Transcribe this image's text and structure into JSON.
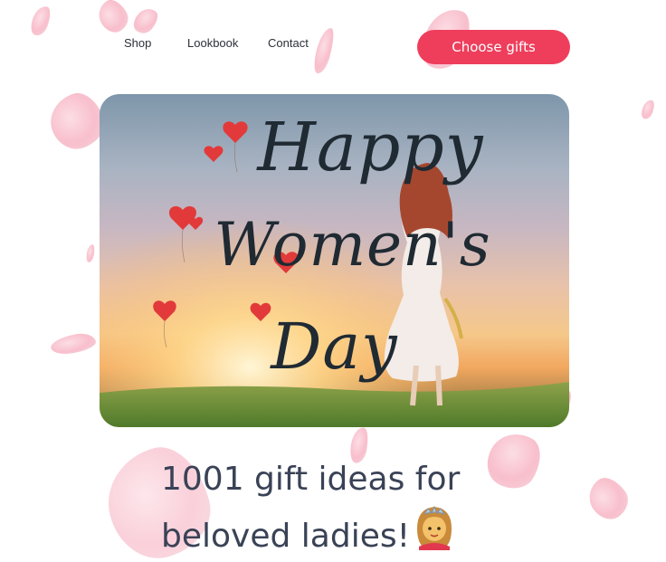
{
  "nav": {
    "links": [
      "Shop",
      "Lookbook",
      "Contact"
    ],
    "cta_label": "Choose gifts"
  },
  "hero": {
    "line1": "Happy",
    "line2": "Women's",
    "line3": "Day"
  },
  "headline": {
    "line1": "1001 gift ideas for",
    "line2": "beloved ladies!",
    "emoji_icon": "woman-with-tiara-emoji-icon"
  },
  "colors": {
    "accent": "#ee3e5c",
    "text": "#3a4256",
    "petal": "#f6a9bb"
  }
}
